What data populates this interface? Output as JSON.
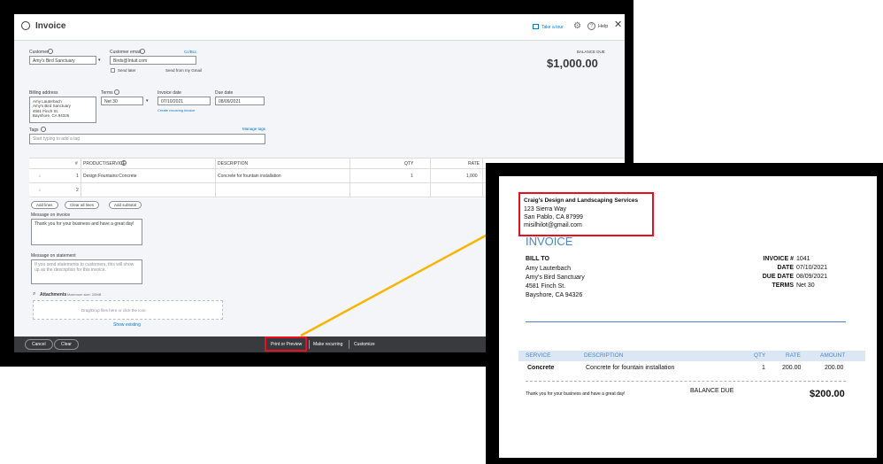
{
  "form": {
    "title": "Invoice",
    "take_tour": "Take a tour",
    "help": "Help",
    "customer_label": "Customer",
    "customer_value": "Amy's Bird Sanctuary",
    "email_label": "Customer email",
    "ccbcc": "Cc/Bcc",
    "email_value": "Birds@Intuit.com",
    "send_later": "Send later",
    "send_from": "Send from my Gmail",
    "balance_due_label": "BALANCE DUE",
    "balance_due_amount": "$1,000.00",
    "billing_label": "Billing address",
    "billing_lines": [
      "Amy Lauterbach",
      "Amy's Bird Sanctuary",
      "4581 Finch St.",
      "Bayshore, CA  94326"
    ],
    "terms_label": "Terms",
    "terms_value": "Net 30",
    "invoice_date_label": "Invoice date",
    "invoice_date_value": "07/10/2021",
    "due_date_label": "Due date",
    "due_date_value": "08/09/2021",
    "recurring_link": "Create recurring invoice",
    "tags_label": "Tags",
    "manage_tags": "Manage tags",
    "tags_placeholder": "Start typing to add a tag",
    "table": {
      "headers": [
        "#",
        "PRODUCT/SERVICE",
        "DESCRIPTION",
        "QTY",
        "RATE"
      ],
      "rows": [
        {
          "num": "1",
          "product": "Design:Fountains:Concrete",
          "desc": "Concrete for fountain installation",
          "qty": "1",
          "rate": "1,000"
        },
        {
          "num": "2",
          "product": "",
          "desc": "",
          "qty": "",
          "rate": ""
        }
      ]
    },
    "add_lines": "Add lines",
    "clear_all_lines": "Clear all lines",
    "add_subtotal": "Add subtotal",
    "msg_invoice_label": "Message on invoice",
    "msg_invoice_value": "Thank you for your business and have a great day!",
    "msg_statement_label": "Message on statement",
    "msg_statement_placeholder": "If you send statements to customers, this will show up as the description for this invoice.",
    "attachments_label": "Attachments",
    "attachments_max": "Maximum size: 20MB",
    "dropzone": "Drag/Drop files here or click the icon",
    "show_existing": "Show existing",
    "bottom": {
      "cancel": "Cancel",
      "clear": "Clear",
      "print_preview": "Print or Preview",
      "make_recurring": "Make recurring",
      "customize": "Customize"
    }
  },
  "preview": {
    "company_name": "Craig's Design and Landscaping Services",
    "company_addr1": "123 Sierra Way",
    "company_addr2": "San Pablo, CA  87999",
    "company_email": "misilhilot@gmail.com",
    "invoice_title": "INVOICE",
    "bill_to_label": "BILL TO",
    "bill_to_lines": [
      "Amy Lauterbach",
      "Amy's Bird Sanctuary",
      "4581 Finch St.",
      "Bayshore, CA  94326"
    ],
    "meta": [
      {
        "label": "INVOICE #",
        "value": "1041"
      },
      {
        "label": "DATE",
        "value": "07/10/2021"
      },
      {
        "label": "DUE DATE",
        "value": "08/09/2021"
      },
      {
        "label": "TERMS",
        "value": "Net 30"
      }
    ],
    "headers": [
      "SERVICE",
      "DESCRIPTION",
      "QTY",
      "RATE",
      "AMOUNT"
    ],
    "row": {
      "service": "Concrete",
      "desc": "Concrete for fountain installation",
      "qty": "1",
      "rate": "200.00",
      "amount": "200.00"
    },
    "thanks": "Thank you for your business and have a great day!",
    "balance_due_label": "BALANCE DUE",
    "balance_due_amount": "$200.00"
  },
  "colors": {
    "highlight": "#e8101e",
    "arrow": "#f7b500",
    "accent": "#0077c5"
  }
}
